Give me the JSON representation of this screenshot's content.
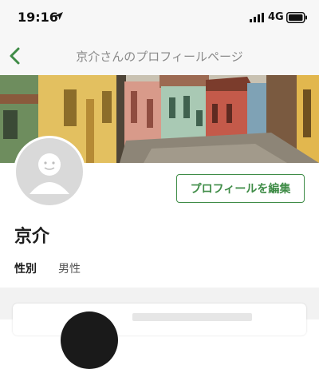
{
  "status_bar": {
    "time": "19:16",
    "network": "4G"
  },
  "nav": {
    "title": "京介さんのプロフィールページ"
  },
  "profile": {
    "name": "京介",
    "edit_label": "プロフィールを編集",
    "gender_label": "性別",
    "gender_value": "男性"
  },
  "colors": {
    "accent": "#3f8c47",
    "nav_title": "#8a8a8a",
    "avatar_bg": "#d9d9d9"
  },
  "icons": {
    "back": "chevron-left-icon",
    "location": "location-arrow-icon",
    "signal": "signal-bars-icon",
    "battery": "battery-icon",
    "avatar": "default-avatar-icon"
  }
}
